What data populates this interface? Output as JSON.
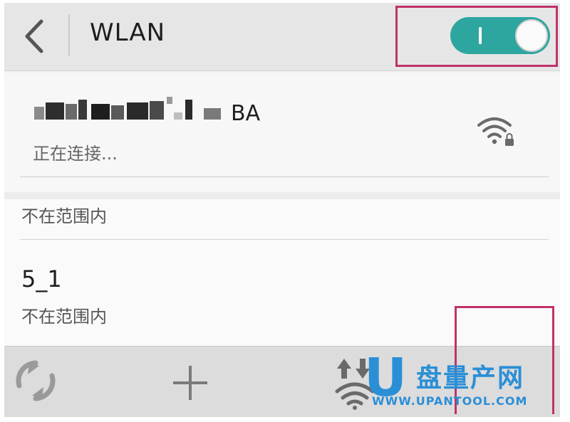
{
  "header": {
    "title": "WLAN",
    "back_icon": "chevron-left-icon",
    "wlan_switch": {
      "state": "on",
      "color": "#2ea6a0"
    }
  },
  "networks": {
    "connecting": {
      "ssid_visible_tail": "BA",
      "status": "正在连接...",
      "icon": "wifi-lock-icon"
    },
    "partial_status": "不在范围内",
    "second": {
      "ssid": "5_1",
      "status": "不在范围内"
    }
  },
  "toolbar": {
    "refresh_icon": "refresh-icon",
    "add_icon": "plus-icon",
    "wifi_transfer_icon": "wifi-transfer-icon"
  },
  "watermark": {
    "logo_letter": "U",
    "text": "盘量产网",
    "url": "WWW.UPANTOOL.COM"
  },
  "colors": {
    "accent": "#2ea6a0",
    "highlight": "#c0326a",
    "watermark": "#2b8fd6"
  }
}
